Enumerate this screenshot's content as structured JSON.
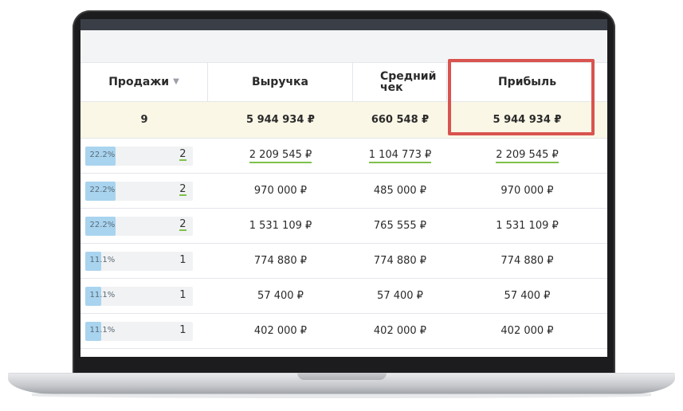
{
  "table": {
    "headers": {
      "sales": "Продажи",
      "revenue": "Выручка",
      "avg_check_line1": "Средний",
      "avg_check_line2": "чек",
      "profit": "Прибыль"
    },
    "totals": {
      "sales": "9",
      "revenue": "5 944 934 ₽",
      "avg_check": "660 548 ₽",
      "profit": "5 944 934 ₽"
    },
    "rows": [
      {
        "pct": "22.2%",
        "share": 0.222,
        "count": "2",
        "revenue": "2 209 545 ₽",
        "avg_check": "1 104 773 ₽",
        "profit": "2 209 545 ₽"
      },
      {
        "pct": "22.2%",
        "share": 0.222,
        "count": "2",
        "revenue": "970 000 ₽",
        "avg_check": "485 000 ₽",
        "profit": "970 000 ₽"
      },
      {
        "pct": "22.2%",
        "share": 0.222,
        "count": "2",
        "revenue": "1 531 109 ₽",
        "avg_check": "765 555 ₽",
        "profit": "1 531 109 ₽"
      },
      {
        "pct": "11.1%",
        "share": 0.111,
        "count": "1",
        "revenue": "774 880 ₽",
        "avg_check": "774 880 ₽",
        "profit": "774 880 ₽"
      },
      {
        "pct": "11.1%",
        "share": 0.111,
        "count": "1",
        "revenue": "57 400 ₽",
        "avg_check": "57 400 ₽",
        "profit": "57 400 ₽"
      },
      {
        "pct": "11.1%",
        "share": 0.111,
        "count": "1",
        "revenue": "402 000 ₽",
        "avg_check": "402 000 ₽",
        "profit": "402 000 ₽"
      }
    ]
  },
  "colors": {
    "bar_fill": "#a9d4ef",
    "highlight": "#d9534f",
    "total_row_bg": "#faf7e6",
    "underline": "#7fc14a"
  },
  "icons": {
    "sort": "sort-down-icon"
  }
}
